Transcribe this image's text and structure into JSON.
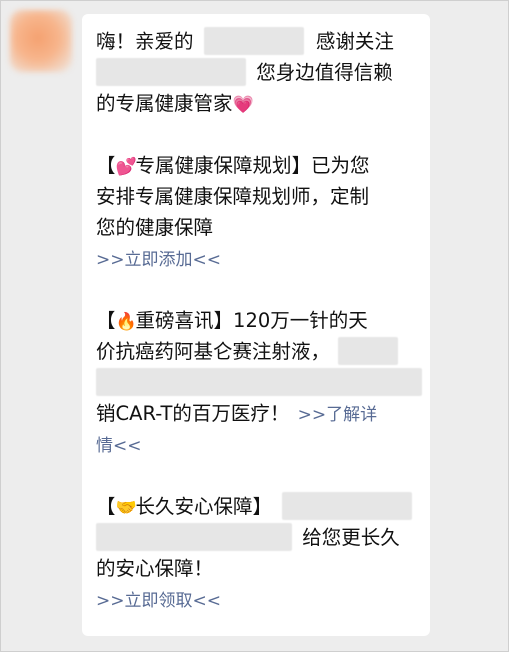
{
  "message": {
    "greeting_prefix": "嗨！亲爱的",
    "greeting_suffix": "感谢关注",
    "line2_suffix": "您身边值得信赖",
    "line3_text": "的专属健康管家",
    "heart_icon": "💗",
    "section1": {
      "bracket_open": "【",
      "emoji": "💕",
      "title": "专属健康保障规划",
      "bracket_close": "】",
      "line1_tail": "已为您",
      "line2": "安排专属健康保障规划师，定制",
      "line3": "您的健康保障",
      "link": ">>立即添加<<"
    },
    "section2": {
      "bracket_open": "【",
      "emoji": "🔥",
      "title": "重磅喜讯",
      "bracket_close": "】",
      "line1_tail": "120万一针的天",
      "line2": "价抗癌药阿基仑赛注射液，",
      "line4_text": "销CAR-T的百万医疗！",
      "link_part1": ">>了解详",
      "link_part2": "情<<"
    },
    "section3": {
      "bracket_open": "【",
      "emoji": "🤝",
      "title": "长久安心保障",
      "bracket_close": "】",
      "line2_tail": "给您更长久",
      "line3": "的安心保障！",
      "link": ">>立即领取<<"
    }
  },
  "colors": {
    "link": "#586b94",
    "text": "#111111",
    "background": "#ededed",
    "bubble": "#ffffff",
    "blur": "#e6e6e6"
  }
}
